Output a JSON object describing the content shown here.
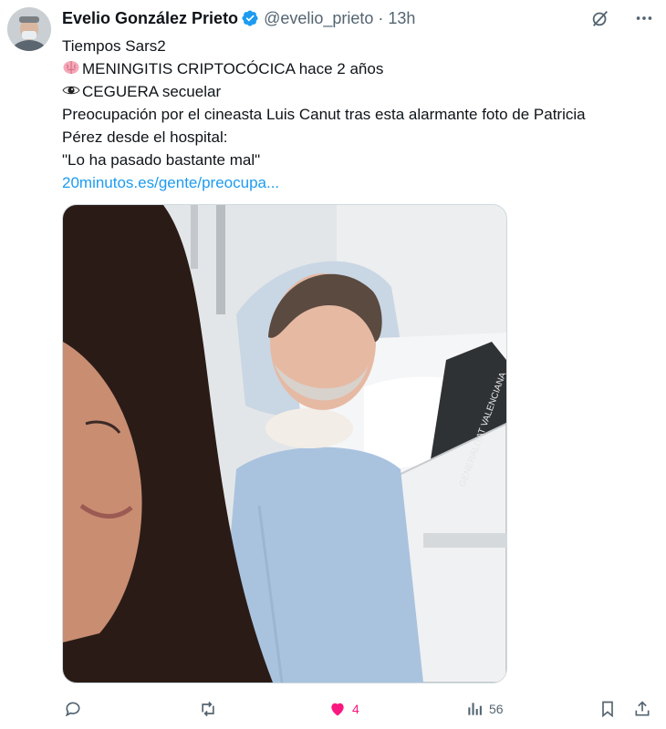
{
  "tweet": {
    "display_name": "Evelio González Prieto",
    "handle": "@evelio_prieto",
    "separator": "·",
    "time": "13h",
    "lines": {
      "l1": "Tiempos Sars2",
      "l2": "MENINGITIS CRIPTOCÓCICA hace 2 años",
      "l3": "CEGUERA secuelar",
      "l4": "Preocupación por el cineasta Luis Canut tras esta alarmante foto de Patricia",
      "l5": "Pérez desde el hospital:",
      "l6": "\"Lo ha pasado bastante mal\""
    },
    "link_text": "20minutos.es/gente/preocupa...",
    "emojis": {
      "brain": "brain-emoji",
      "eye": "eye-emoji"
    }
  },
  "media": {
    "bed_label": "GENERALITAT VALENCIANA"
  },
  "actions": {
    "reply_count": "",
    "retweet_count": "",
    "like_count": "4",
    "views_count": "56"
  },
  "colors": {
    "link": "#1d9bf0",
    "like": "#f91880",
    "muted": "#536471",
    "verified": "#1d9bf0"
  }
}
